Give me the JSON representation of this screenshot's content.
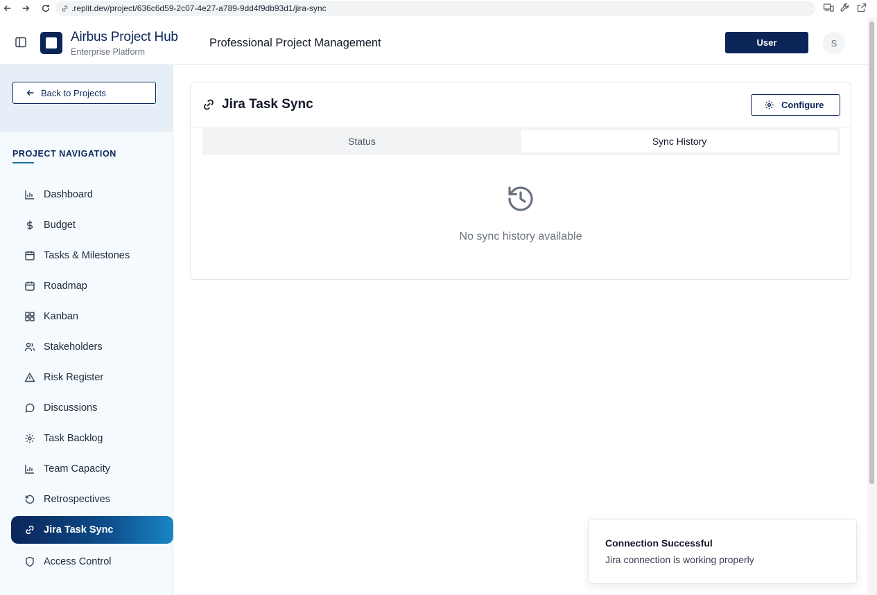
{
  "browser": {
    "url": ".replit.dev/project/636c6d59-2c07-4e27-a789-9dd4f9db93d1/jira-sync"
  },
  "header": {
    "brand_title": "Airbus Project Hub",
    "brand_subtitle": "Enterprise Platform",
    "page_title": "Professional Project Management",
    "user_button": "User",
    "avatar_initial": "S"
  },
  "sidebar": {
    "back_label": "Back to Projects",
    "heading": "PROJECT NAVIGATION",
    "items": [
      {
        "label": "Dashboard",
        "icon": "bar-chart-icon"
      },
      {
        "label": "Budget",
        "icon": "dollar-icon"
      },
      {
        "label": "Tasks & Milestones",
        "icon": "calendar-icon"
      },
      {
        "label": "Roadmap",
        "icon": "calendar-icon"
      },
      {
        "label": "Kanban",
        "icon": "grid-icon"
      },
      {
        "label": "Stakeholders",
        "icon": "users-icon"
      },
      {
        "label": "Risk Register",
        "icon": "warning-icon"
      },
      {
        "label": "Discussions",
        "icon": "message-icon"
      },
      {
        "label": "Task Backlog",
        "icon": "gear-icon"
      },
      {
        "label": "Team Capacity",
        "icon": "bar-chart-icon"
      },
      {
        "label": "Retrospectives",
        "icon": "rotate-icon"
      },
      {
        "label": "Jira Task Sync",
        "icon": "link-icon",
        "active": true
      },
      {
        "label": "Access Control",
        "icon": "shield-icon"
      }
    ]
  },
  "main": {
    "title": "Jira Task Sync",
    "configure_label": "Configure",
    "tabs": [
      {
        "label": "Status",
        "selected": false
      },
      {
        "label": "Sync History",
        "selected": true
      }
    ],
    "empty_message": "No sync history available"
  },
  "toast": {
    "title": "Connection Successful",
    "message": "Jira connection is working properly"
  },
  "colors": {
    "brand_navy": "#0b2559",
    "active_gradient_end": "#1a85c4",
    "sidebar_bg": "#f4fafd"
  }
}
